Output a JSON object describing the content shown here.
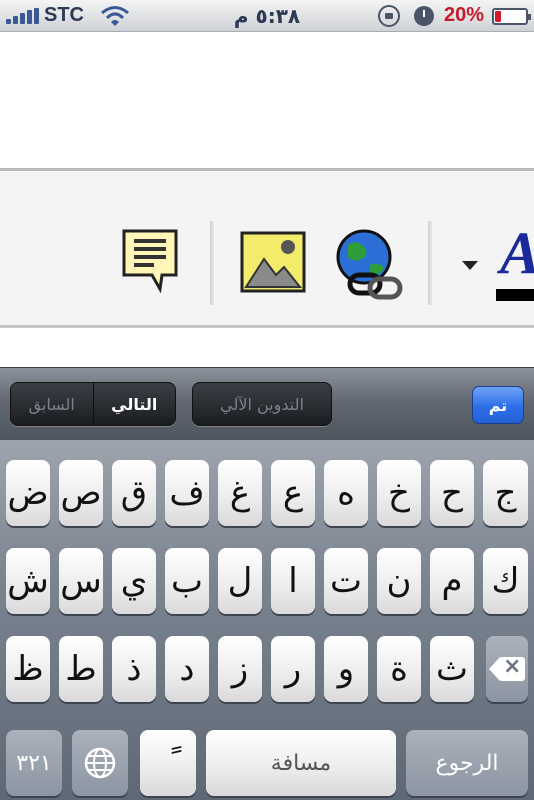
{
  "status_bar": {
    "carrier": "STC",
    "time": "٥:٣٨ م",
    "battery_percent": "20%",
    "battery_level": 0.2,
    "icons": [
      "signal-bars-icon",
      "wifi-icon",
      "rotation-lock-icon",
      "alarm-icon",
      "battery-icon"
    ]
  },
  "toolbar": {
    "icons": [
      "note-comment-icon",
      "insert-image-icon",
      "hyperlink-globe-icon",
      "dropdown-arrow-icon",
      "font-color-icon"
    ],
    "font_glyph": "A"
  },
  "accessory_bar": {
    "previous_label": "السابق",
    "next_label": "التالي",
    "autofill_label": "التدوين الآلي",
    "done_label": "تم"
  },
  "keyboard": {
    "row1": [
      "ض",
      "ص",
      "ق",
      "ف",
      "غ",
      "ع",
      "ه",
      "خ",
      "ح",
      "ج"
    ],
    "row2": [
      "ش",
      "س",
      "ي",
      "ب",
      "ل",
      "ا",
      "ت",
      "ن",
      "م",
      "ك"
    ],
    "row3": [
      "ظ",
      "ط",
      "ذ",
      "د",
      "ز",
      "ر",
      "و",
      "ة",
      "ث"
    ],
    "numbers_key": "٣٢١",
    "globe_icon": "globe-icon",
    "diacritic_key": "ً",
    "space_label": "مسافة",
    "return_label": "الرجوع",
    "backspace_icon": "backspace-icon"
  }
}
